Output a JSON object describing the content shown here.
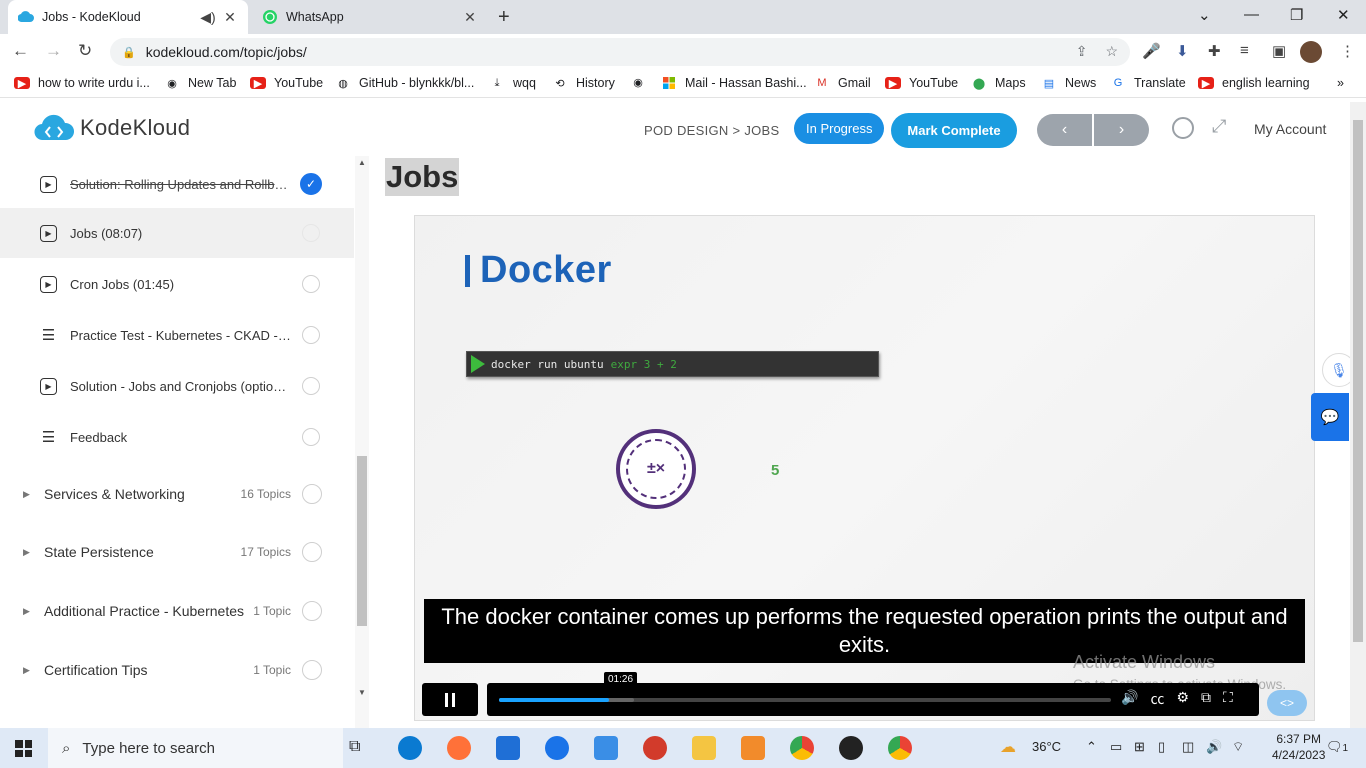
{
  "browser": {
    "tabs": [
      {
        "title": "Jobs - KodeKloud",
        "active": true
      },
      {
        "title": "WhatsApp",
        "active": false
      }
    ],
    "new_tab": "+",
    "url": "kodekloud.com/topic/jobs/",
    "bookmarks": [
      {
        "label": "how to write urdu i...",
        "icon": "youtube-icon"
      },
      {
        "label": "New Tab",
        "icon": "globe-icon"
      },
      {
        "label": "YouTube",
        "icon": "youtube-icon"
      },
      {
        "label": "GitHub - blynkkk/bl...",
        "icon": "github-icon"
      },
      {
        "label": "wqq",
        "icon": "download-icon"
      },
      {
        "label": "History",
        "icon": "history-icon"
      },
      {
        "label": "",
        "icon": "globe-icon"
      },
      {
        "label": "Mail - Hassan Bashi...",
        "icon": "microsoft-icon"
      },
      {
        "label": "Gmail",
        "icon": "gmail-icon"
      },
      {
        "label": "YouTube",
        "icon": "youtube-icon"
      },
      {
        "label": "Maps",
        "icon": "maps-icon"
      },
      {
        "label": "News",
        "icon": "news-icon"
      },
      {
        "label": "Translate",
        "icon": "translate-icon"
      },
      {
        "label": "english learning",
        "icon": "youtube-icon"
      }
    ]
  },
  "site": {
    "logo": "KodeKloud",
    "breadcrumb": "POD DESIGN > JOBS",
    "status_button": "In Progress",
    "mark_complete": "Mark Complete",
    "prev": "‹",
    "next": "›",
    "account": "My Account"
  },
  "sidebar": {
    "lessons": [
      {
        "title": "Solution: Rolling Updates and Rollbacks",
        "icon": "video-icon",
        "state": "done"
      },
      {
        "title": "Jobs (08:07)",
        "icon": "video-icon",
        "state": "current"
      },
      {
        "title": "Cron Jobs (01:45)",
        "icon": "video-icon",
        "state": "todo"
      },
      {
        "title": "Practice Test - Kubernetes - CKAD - Jobs",
        "icon": "list-icon",
        "state": "todo"
      },
      {
        "title": "Solution - Jobs and Cronjobs (optional)",
        "icon": "video-icon",
        "state": "todo"
      },
      {
        "title": "Feedback",
        "icon": "list-icon",
        "state": "todo"
      }
    ],
    "sections": [
      {
        "title": "Services & Networking",
        "count": "16 Topics"
      },
      {
        "title": "State Persistence",
        "count": "17 Topics"
      },
      {
        "title": "Additional Practice - Kubernetes",
        "count": "1 Topic"
      },
      {
        "title": "Certification Tips",
        "count": "1 Topic"
      }
    ]
  },
  "main": {
    "title": "Jobs",
    "video": {
      "slide_heading": "Docker",
      "command": "docker run ubuntu",
      "command_args": "expr 3 + 2",
      "result": "5",
      "caption": "The docker container comes up performs the requested operation prints the output and exits.",
      "time_tooltip": "01:26",
      "played_fraction": 0.18,
      "buffered_fraction": 0.22
    },
    "watermark_line1": "Activate Windows",
    "watermark_line2": "Go to Settings to activate Windows."
  },
  "taskbar": {
    "search_placeholder": "Type here to search",
    "temperature": "36°C",
    "time": "6:37 PM",
    "date": "4/24/2023",
    "notifications": "1"
  }
}
